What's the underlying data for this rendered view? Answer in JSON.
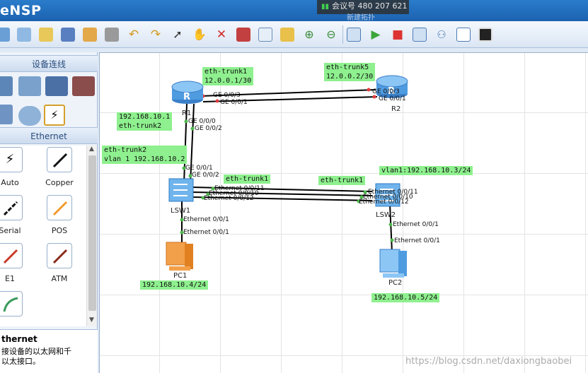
{
  "app": {
    "title": "eNSP"
  },
  "meeting": {
    "text": "会议号 480 207 621",
    "subtitle": "新建拓扑"
  },
  "left_panel": {
    "devices_header": "设备连线",
    "cable_header": "Ethernet",
    "cables": [
      {
        "label": "Auto",
        "icon": "lightning-icon"
      },
      {
        "label": "Copper",
        "icon": "black-cable-icon"
      },
      {
        "label": "Serial",
        "icon": "serial-cable-icon"
      },
      {
        "label": "POS",
        "icon": "orange-cable-icon"
      },
      {
        "label": "E1",
        "icon": "red-cable-icon"
      },
      {
        "label": "ATM",
        "icon": "darkred-cable-icon"
      },
      {
        "label": "",
        "icon": "green-curve-cable-icon"
      }
    ],
    "desc_title": "thernet",
    "desc_text": "接设备的以太网和千\n以太接口。"
  },
  "topology": {
    "devices": [
      {
        "name": "R1",
        "type": "router"
      },
      {
        "name": "R2",
        "type": "router"
      },
      {
        "name": "LSW1",
        "type": "switch"
      },
      {
        "name": "LSW2",
        "type": "switch"
      },
      {
        "name": "PC1",
        "type": "pc"
      },
      {
        "name": "PC2",
        "type": "pc"
      }
    ],
    "notes": [
      "eth-trunk1\n12.0.0.1/30",
      "eth-trunk5\n12.0.0.2/30",
      "192.168.10.1\neth-trunk2",
      "eth-trunk2\nvlan 1 192.168.10.2",
      "eth-trunk1",
      "eth-trunk1",
      "vlan1:192.168.10.3/24",
      "192.168.10.4/24",
      "192.168.10.5/24"
    ],
    "ports": [
      "GE 0/0/3",
      "GE 0/0/1",
      "GE 0/0/3",
      "GE 0/0/1",
      "GE 0/0/0",
      "GE 0/0/2",
      "GE 0/0/1",
      "GE 0/0/2",
      "Ethernet 0/0/11",
      "Ethernet 0/0/10",
      "Ethernet 0/0/12",
      "Ethernet 0/0/11",
      "Ethernet 0/0/10",
      "Ethernet 0/0/12",
      "Ethernet 0/0/1",
      "Ethernet 0/0/1",
      "Ethernet 0/0/1",
      "Ethernet 0/0/1"
    ]
  },
  "watermark": "https://blog.csdn.net/daxiongbaobei",
  "colors": {
    "note_bg": "#8ef08e",
    "titlebar": "#1b62b0",
    "link": "#000000"
  }
}
